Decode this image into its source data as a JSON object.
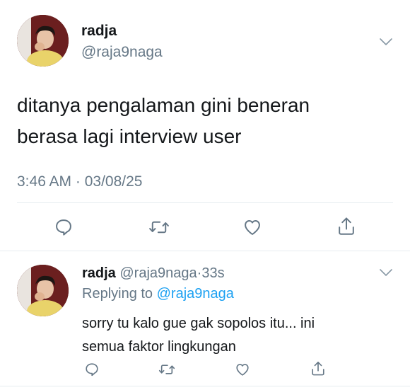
{
  "main_tweet": {
    "display_name": "radja",
    "handle": "@raja9naga",
    "text_line1": "ditanya pengalaman gini beneran",
    "text_line2": "berasa lagi interview user",
    "timestamp": "3:46 AM · 03/08/25"
  },
  "reply_tweet": {
    "display_name": "radja",
    "handle": "@raja9naga",
    "separator": "·",
    "time_ago": "33s",
    "replying_prefix": "Replying to",
    "replying_to": "@raja9naga",
    "text_line1": "sorry tu kalo gue gak sopolos itu... ini",
    "text_line2": "semua faktor lingkungan"
  },
  "colors": {
    "text_primary": "#14171a",
    "text_secondary": "#657786",
    "link": "#1da1f2",
    "icon": "#657786",
    "divider": "#e6ecf0"
  },
  "icons": [
    "reply-icon",
    "retweet-icon",
    "like-icon",
    "share-icon",
    "chevron-down-icon"
  ]
}
